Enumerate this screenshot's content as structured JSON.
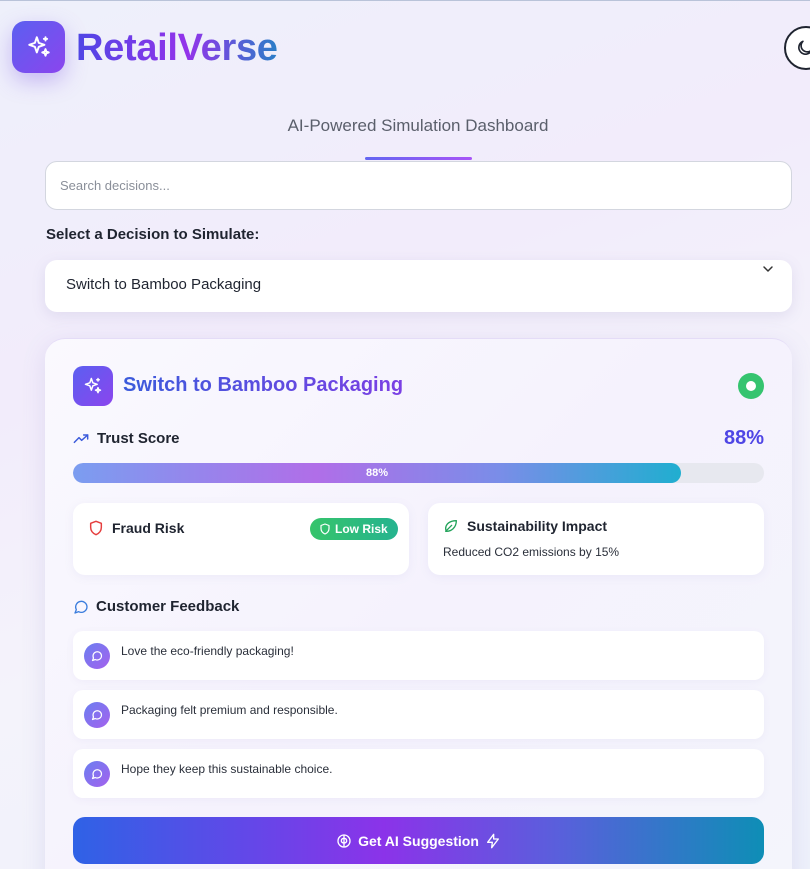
{
  "app": {
    "brand": "RetailVerse",
    "subtitle": "AI-Powered Simulation Dashboard",
    "logo_icon": "sparkles-icon",
    "theme_icon": "moon-icon"
  },
  "search": {
    "placeholder": "Search decisions...",
    "value": ""
  },
  "decision_select": {
    "label": "Select a Decision to Simulate:",
    "selected": "Switch to Bamboo Packaging",
    "icon": "chevron-down-icon"
  },
  "card": {
    "title": "Switch to Bamboo Packaging",
    "status": "active",
    "trust": {
      "label": "Trust Score",
      "value_text": "88%",
      "bar_text": "88%",
      "percent": 88
    },
    "fraud": {
      "label": "Fraud Risk",
      "badge": "Low Risk"
    },
    "sustainability": {
      "label": "Sustainability Impact",
      "description": "Reduced CO2 emissions by 15%"
    },
    "feedback": {
      "title": "Customer Feedback",
      "items": [
        {
          "text": "Love the eco-friendly packaging!"
        },
        {
          "text": "Packaging felt premium and responsible."
        },
        {
          "text": "Hope they keep this sustainable choice."
        }
      ]
    },
    "ai_button": {
      "label": "Get AI Suggestion"
    }
  },
  "colors": {
    "accent": "#4f46e5",
    "accent_purple": "#9333ea",
    "success": "#35c46f",
    "danger": "#e53e3e"
  }
}
